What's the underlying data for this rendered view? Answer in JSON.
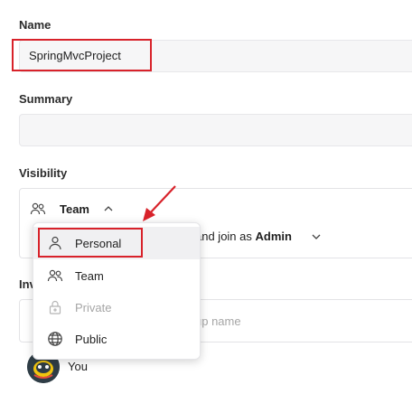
{
  "form": {
    "name": {
      "label": "Name",
      "value": "SpringMvcProject"
    },
    "summary": {
      "label": "Summary",
      "value": ""
    },
    "visibility": {
      "label": "Visibility",
      "selected": "Team",
      "join_text": "and join as",
      "join_role": "Admin"
    },
    "invite": {
      "label_partial": "Inv",
      "input_placeholder_partial": "up name",
      "member_name": "You"
    }
  },
  "dropdown": {
    "items": [
      {
        "label": "Personal",
        "icon": "user-icon",
        "disabled": false,
        "highlighted": true
      },
      {
        "label": "Team",
        "icon": "team-icon",
        "disabled": false,
        "highlighted": false
      },
      {
        "label": "Private",
        "icon": "lock-icon",
        "disabled": true,
        "highlighted": false
      },
      {
        "label": "Public",
        "icon": "globe-icon",
        "disabled": false,
        "highlighted": false
      }
    ]
  },
  "colors": {
    "annotation_red": "#d8222a",
    "field_bg": "#f6f6f7",
    "hover_bg": "#f0f0f2"
  }
}
